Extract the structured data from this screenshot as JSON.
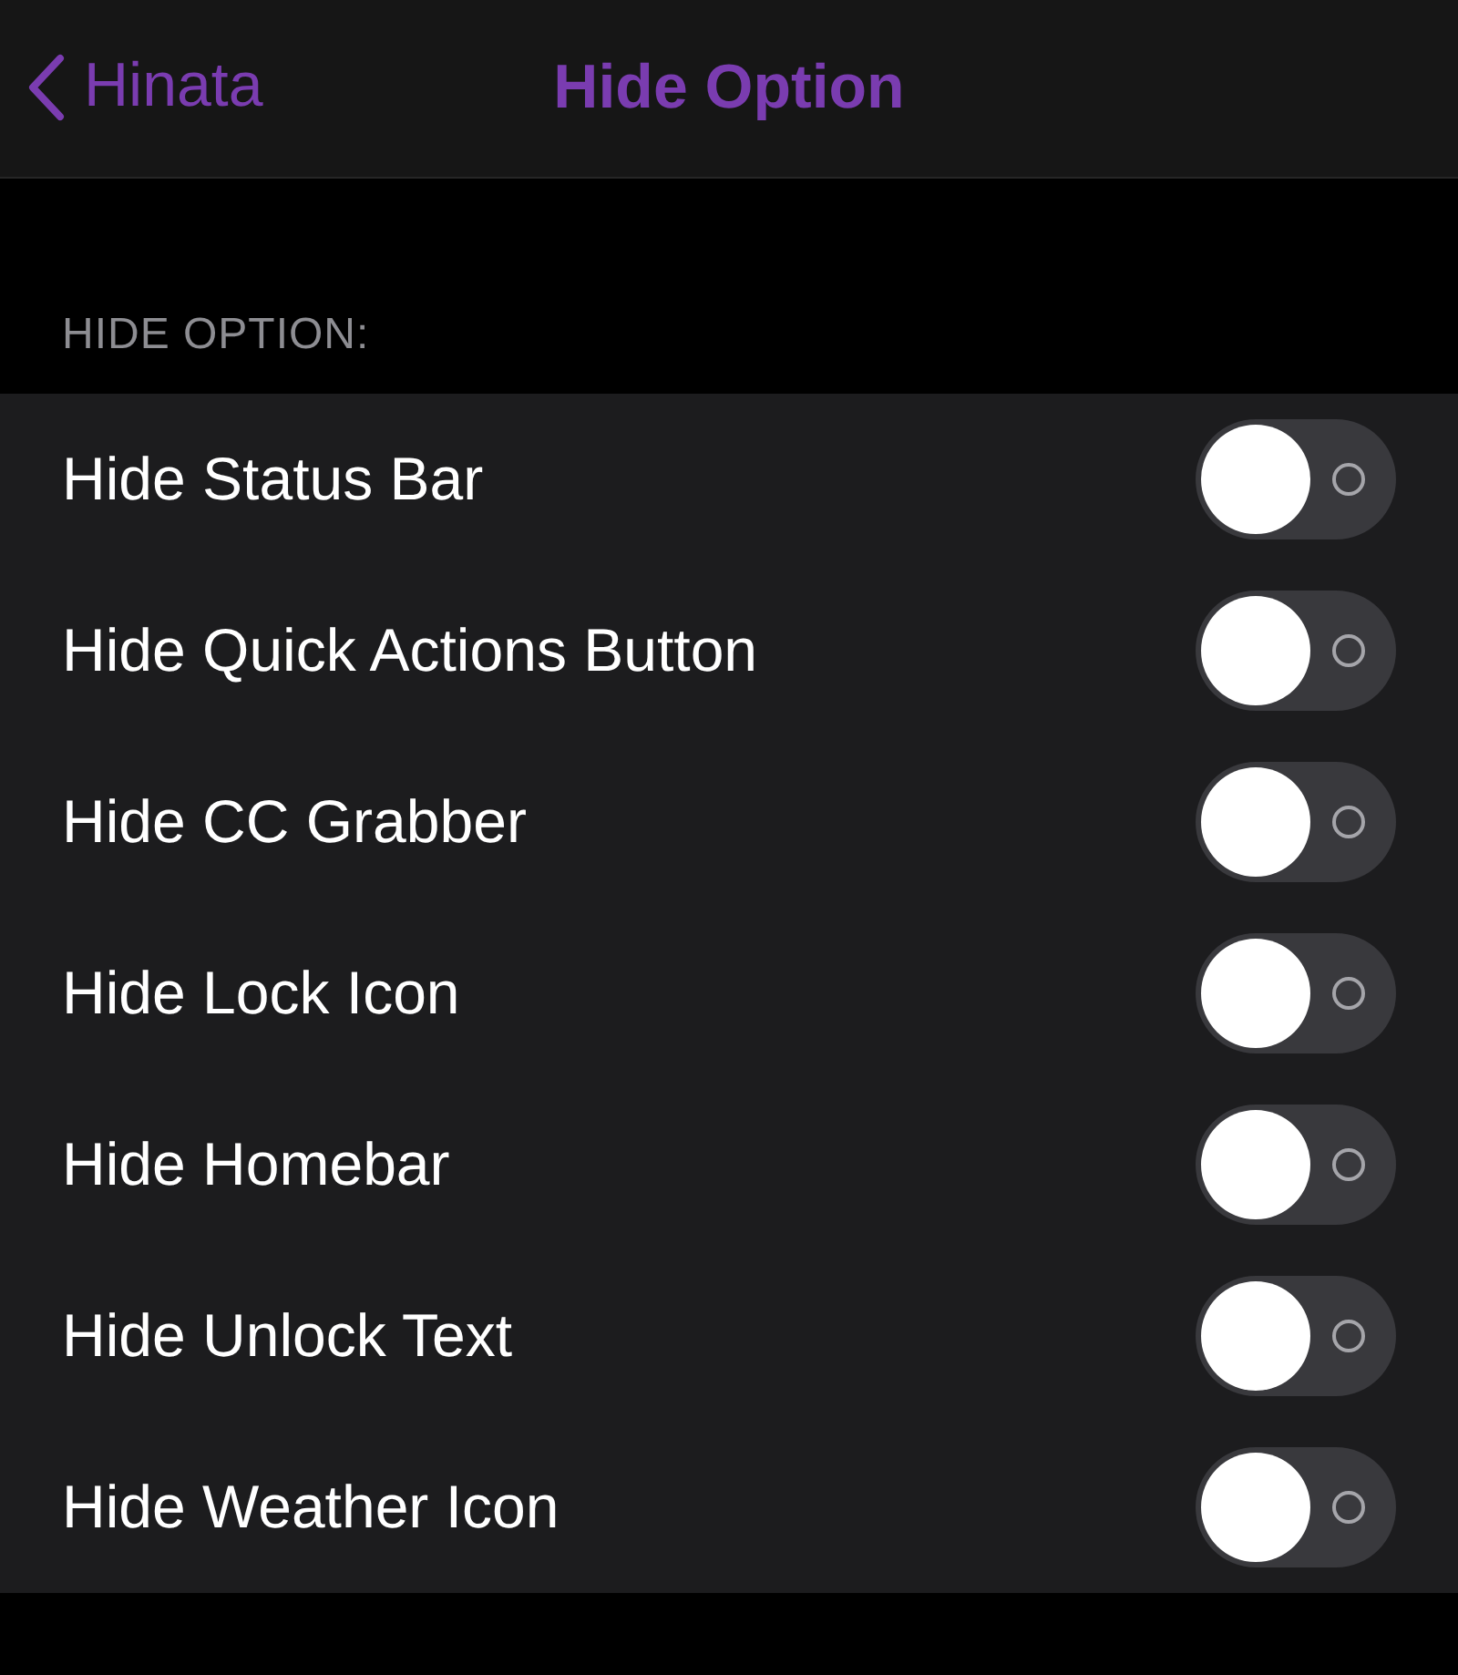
{
  "nav": {
    "back_label": "Hinata",
    "title": "Hide Option"
  },
  "section": {
    "header": "HIDE OPTION:",
    "rows": [
      {
        "label": "Hide Status Bar",
        "on": false
      },
      {
        "label": "Hide Quick Actions Button",
        "on": false
      },
      {
        "label": "Hide CC Grabber",
        "on": false
      },
      {
        "label": "Hide Lock Icon",
        "on": false
      },
      {
        "label": "Hide Homebar",
        "on": false
      },
      {
        "label": "Hide Unlock Text",
        "on": false
      },
      {
        "label": "Hide Weather Icon",
        "on": false
      }
    ]
  }
}
